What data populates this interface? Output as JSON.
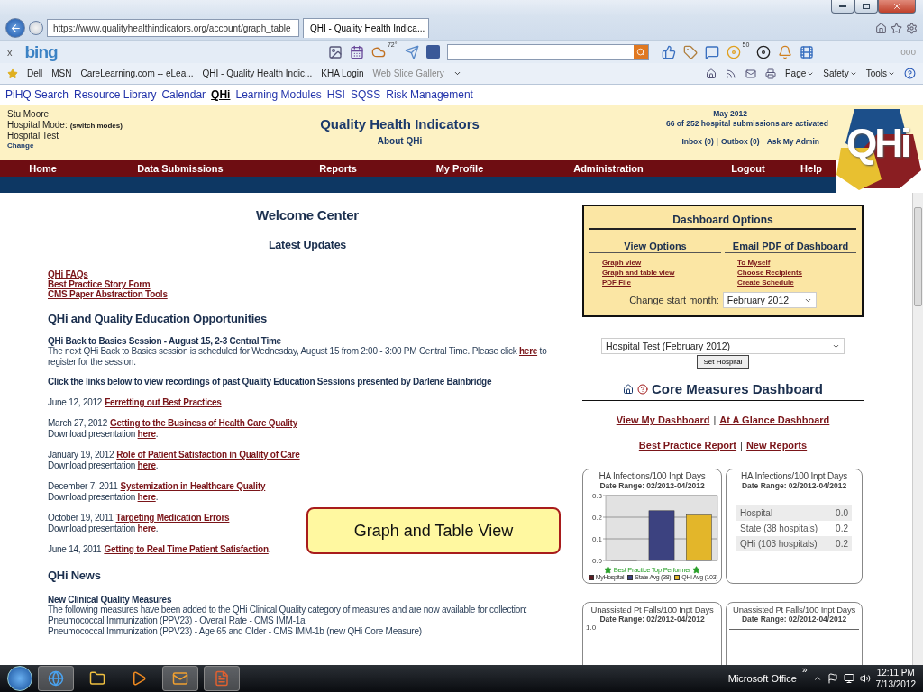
{
  "browser": {
    "address": "https://www.qualityhealthindicators.org/account/graph_table",
    "tabs": [
      {
        "label": "QHI - Quality Health Indica...",
        "selected": true
      }
    ],
    "bing": {
      "close": "x",
      "logo": "bing",
      "weather_badge": "72°",
      "count_badge": "50",
      "more": "ooo"
    },
    "favorites": [
      {
        "label": "Dell"
      },
      {
        "label": "MSN"
      },
      {
        "label": "CareLearning.com -- eLea..."
      },
      {
        "label": "QHI - Quality Health Indic..."
      },
      {
        "label": "KHA Login"
      },
      {
        "label": "Web Slice Gallery",
        "dim": true
      }
    ],
    "commands": [
      {
        "label": "Page"
      },
      {
        "label": "Safety"
      },
      {
        "label": "Tools"
      }
    ]
  },
  "site_nav": [
    {
      "label": "PiHQ Search",
      "selected": false
    },
    {
      "label": "Resource Library",
      "selected": false
    },
    {
      "label": "Calendar",
      "selected": false
    },
    {
      "label": "QHi",
      "selected": true
    },
    {
      "label": "Learning Modules",
      "selected": false
    },
    {
      "label": "HSI",
      "selected": false
    },
    {
      "label": "SQSS",
      "selected": false
    },
    {
      "label": "Risk Management",
      "selected": false
    }
  ],
  "header": {
    "user": "Stu Moore",
    "mode_label": "Hospital Mode:",
    "mode_link": "(switch modes)",
    "hospital": "Hospital Test",
    "change": "Change",
    "title": "Quality Health Indicators",
    "about": "About QHi",
    "month": "May 2012",
    "activation": "66 of 252 hospital submissions are activated",
    "inbox": [
      "Inbox (0)",
      "Outbox (0)",
      "Ask My Admin"
    ],
    "inbox_separator": "|",
    "logo": "QHi"
  },
  "menu": [
    "Home",
    "Data Submissions",
    "Reports",
    "My Profile",
    "Administration",
    "Logout",
    "Help"
  ],
  "welcome": {
    "title": "Welcome Center",
    "subtitle": "Latest Updates",
    "quick_links": [
      "QHi FAQs",
      "Best Practice Story Form",
      "CMS Paper Abstraction Tools"
    ],
    "education_heading": "QHi and Quality Education Opportunities",
    "session_title": "QHi Back to Basics Session - August 15, 2-3 Central Time",
    "session_text": {
      "before": "The next QHi Back to Basics session is scheduled for Wednesday, August 15 from 2:00 - 3:00 PM Central Time. Please click ",
      "link": "here",
      "after": " to register for the session."
    },
    "recordings_intro": "Click the links below to view recordings of past Quality Education Sessions presented by Darlene Bainbridge",
    "recordings": [
      {
        "date": "June 12, 2012",
        "title": "Ferretting out Best Practices"
      },
      {
        "date": "March 27, 2012",
        "title": "Getting to the Business of Health Care Quality",
        "download": {
          "label": "Download presentation ",
          "link": "here",
          "end": "."
        }
      },
      {
        "date": "January 19, 2012",
        "title": "Role of Patient Satisfaction in Quality of Care",
        "download": {
          "label": "Download presentation ",
          "link": "here",
          "end": "."
        }
      },
      {
        "date": "December 7, 2011",
        "title": "Systemization in Healthcare Quality",
        "download": {
          "label": "Download presentation ",
          "link": "here",
          "end": "."
        }
      },
      {
        "date": "October 19, 2011",
        "title": "Targeting Medication Errors",
        "download": {
          "label": "Download presentation ",
          "link": "here",
          "end": "."
        }
      },
      {
        "date": "June 14, 2011",
        "title": "Getting to Real Time Patient Satisfaction",
        "end": "."
      }
    ],
    "news_heading": "QHi News",
    "news_title": "New Clinical Quality Measures",
    "news_lines": [
      "The following measures have been added to the QHi Clinical Quality category of measures and are now available for collection:",
      "Pneumococcal Immunization (PPV23) - Overall Rate - CMS IMM-1a",
      "Pneumococcal Immunization (PPV23) - Age 65 and Older - CMS IMM-1b (new QHi Core Measure)"
    ]
  },
  "callout": "Graph and Table View",
  "dashboard_options": {
    "title": "Dashboard Options",
    "columns": [
      {
        "heading": "View Options",
        "links": [
          "Graph view",
          "Graph and table view",
          "PDF File"
        ]
      },
      {
        "heading": "Email PDF of Dashboard",
        "links": [
          "To Myself",
          "Choose Recipients",
          "Create Schedule"
        ]
      }
    ],
    "start_month_label": "Change start month:",
    "start_month": "February 2012"
  },
  "hospital_select": {
    "value": "Hospital Test (February 2012)",
    "button": "Set Hospital"
  },
  "core": {
    "title": "Core Measures Dashboard",
    "link_rows": [
      [
        "View My Dashboard",
        "At A Glance Dashboard"
      ],
      [
        "Best Practice Report",
        "New Reports"
      ]
    ],
    "separator": "|"
  },
  "cards": [
    {
      "kind": "chart",
      "date_range": "Date Range: 02/2012-04/2012",
      "footnote": "Best Practice Top Performer",
      "chart_data": {
        "type": "bar",
        "title": "HA Infections/100 Inpt Days",
        "series": [
          {
            "name": "MyHospital",
            "color": "#5a1c22",
            "values": [
              0
            ]
          },
          {
            "name": "State Avg (38)",
            "color": "#3c4280",
            "values": [
              0.23
            ]
          },
          {
            "name": "QHi Avg (103)",
            "color": "#e3b62a",
            "values": [
              0.21
            ]
          }
        ],
        "ylim": [
          0,
          0.3
        ],
        "yticks": [
          {
            "value": 0,
            "label": "0.0"
          },
          {
            "value": 0.1,
            "label": "0.1"
          },
          {
            "value": 0.2,
            "label": "0.2"
          },
          {
            "value": 0.3,
            "label": "0.3"
          }
        ]
      }
    },
    {
      "kind": "table",
      "title": "HA Infections/100 Inpt Days",
      "date_range": "Date Range: 02/2012-04/2012",
      "rows": [
        {
          "label": "Hospital",
          "value": "0.0"
        },
        {
          "label": "State (38 hospitals)",
          "value": "0.2"
        },
        {
          "label": "QHi (103 hospitals)",
          "value": "0.2"
        }
      ]
    },
    {
      "kind": "chart_stub",
      "title": "Unassisted Pt Falls/100 Inpt Days",
      "date_range": "Date Range: 02/2012-04/2012",
      "tick": "1.0"
    },
    {
      "kind": "table_stub",
      "title": "Unassisted Pt Falls/100 Inpt Days",
      "date_range": "Date Range: 02/2012-04/2012"
    }
  ],
  "taskbar": {
    "apps": [
      {
        "kind": "browser",
        "selected": true
      },
      {
        "kind": "folder",
        "selected": false
      },
      {
        "kind": "media",
        "selected": false
      },
      {
        "kind": "mail",
        "selected": true
      },
      {
        "kind": "slides",
        "selected": true
      }
    ],
    "toolbar": "Microsoft Office",
    "expand": "»",
    "time": "12:11 PM",
    "date": "7/13/2012"
  }
}
